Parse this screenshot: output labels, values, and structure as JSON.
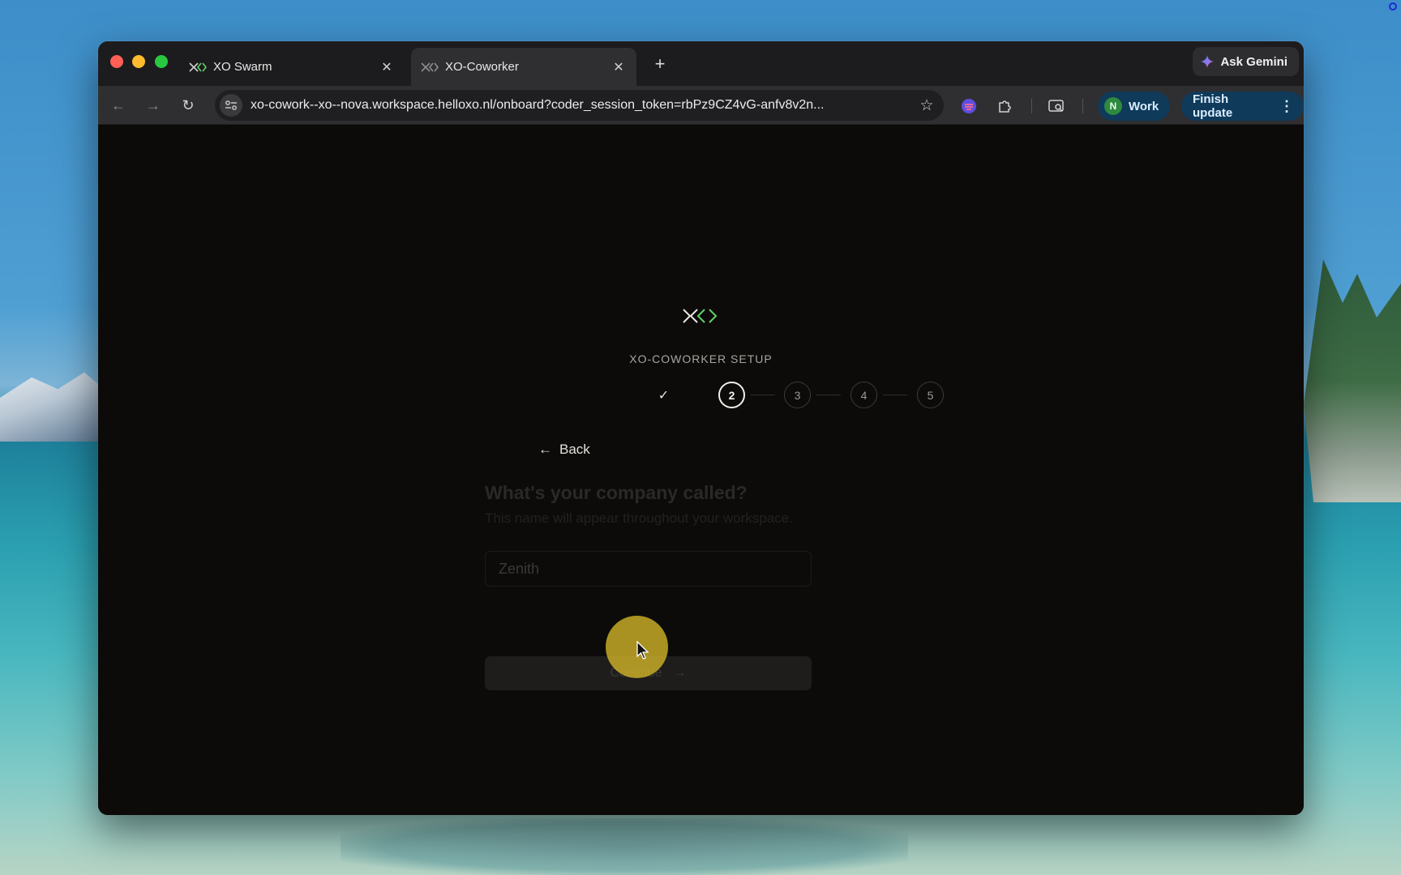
{
  "browser": {
    "tabs": [
      {
        "title": "XO Swarm",
        "active": false
      },
      {
        "title": "XO-Coworker",
        "active": true
      }
    ],
    "new_tab_icon": "plus-icon",
    "ask_gemini_label": "Ask Gemini",
    "url": "xo-cowork--xo--nova.workspace.helloxo.nl/onboard?coder_session_token=rbPz9CZ4vG-anfv8v2n...",
    "profile": {
      "initial": "N",
      "label": "Work",
      "avatar_color": "#2d8a3e"
    },
    "finish_update_label": "Finish update"
  },
  "setup": {
    "logo_icon": "xo-logo-icon",
    "title": "XO-COWORKER SETUP",
    "steps": {
      "done_mark": "✓",
      "current": "2",
      "s3": "3",
      "s4": "4",
      "s5": "5"
    },
    "back_label": "Back",
    "question": "What's your company called?",
    "subtitle": "This name will appear throughout your workspace.",
    "company_input": {
      "value": "Zenith"
    },
    "continue_label": "Continue",
    "continue_arrow": "→"
  },
  "colors": {
    "accent_green": "#5fd16a",
    "chip_blue": "#0f3a5a",
    "click_highlight": "#d6b928"
  }
}
